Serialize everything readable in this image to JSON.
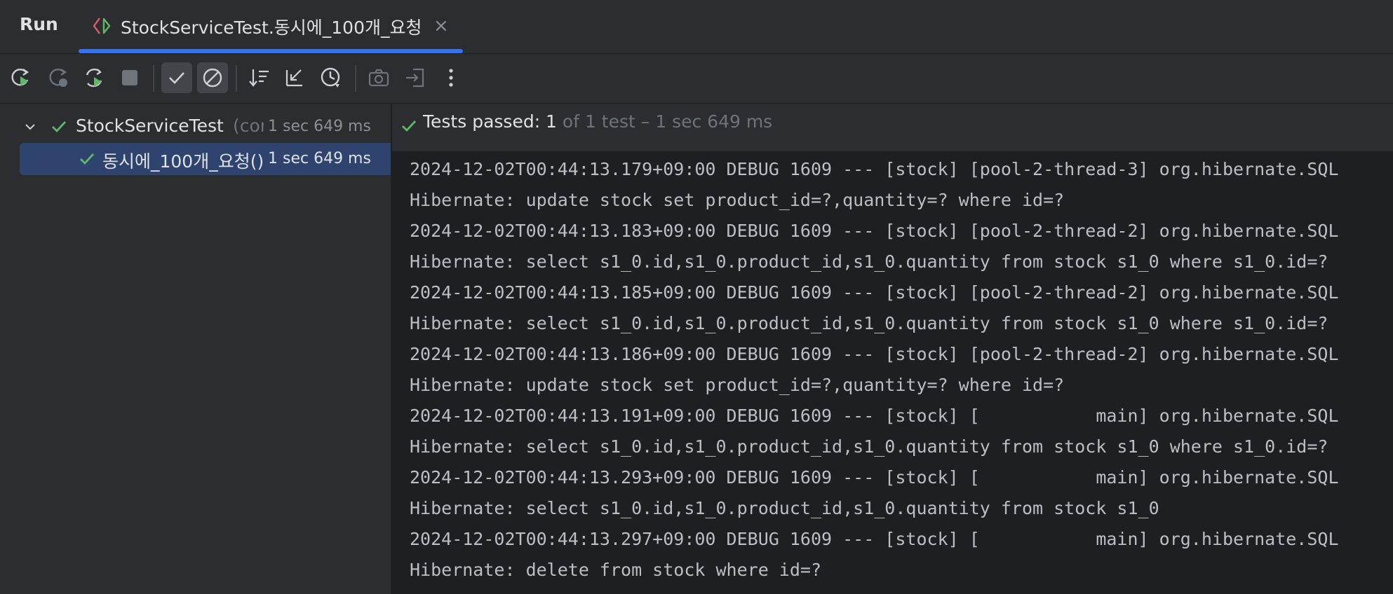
{
  "tabbar": {
    "run_label": "Run",
    "tab_title": "StockServiceTest.동시에_100개_요청",
    "close_glyph": "×"
  },
  "toolbar": {
    "buttons": [
      "rerun-icon",
      "rerun-failed-icon",
      "toggle-auto-test-icon",
      "stop-icon",
      "show-passed-icon",
      "show-ignored-icon",
      "sort-icon",
      "collapse-icon",
      "history-icon",
      "export-icon",
      "import-icon",
      "more-icon"
    ]
  },
  "tree": {
    "root": {
      "name": "StockServiceTest",
      "extra": "(com",
      "time": "1 sec 649 ms"
    },
    "child": {
      "name": "동시에_100개_요청()",
      "time": "1 sec 649 ms"
    }
  },
  "status": {
    "passed_label": "Tests passed: 1",
    "detail": " of 1 test – 1 sec 649 ms"
  },
  "console": {
    "lines": [
      "2024-12-02T00:44:13.179+09:00 DEBUG 1609 --- [stock] [pool-2-thread-3] org.hibernate.SQL",
      "Hibernate: update stock set product_id=?,quantity=? where id=?",
      "2024-12-02T00:44:13.183+09:00 DEBUG 1609 --- [stock] [pool-2-thread-2] org.hibernate.SQL",
      "Hibernate: select s1_0.id,s1_0.product_id,s1_0.quantity from stock s1_0 where s1_0.id=?",
      "2024-12-02T00:44:13.185+09:00 DEBUG 1609 --- [stock] [pool-2-thread-2] org.hibernate.SQL",
      "Hibernate: select s1_0.id,s1_0.product_id,s1_0.quantity from stock s1_0 where s1_0.id=?",
      "2024-12-02T00:44:13.186+09:00 DEBUG 1609 --- [stock] [pool-2-thread-2] org.hibernate.SQL",
      "Hibernate: update stock set product_id=?,quantity=? where id=?",
      "2024-12-02T00:44:13.191+09:00 DEBUG 1609 --- [stock] [           main] org.hibernate.SQL",
      "Hibernate: select s1_0.id,s1_0.product_id,s1_0.quantity from stock s1_0 where s1_0.id=?",
      "2024-12-02T00:44:13.293+09:00 DEBUG 1609 --- [stock] [           main] org.hibernate.SQL",
      "Hibernate: select s1_0.id,s1_0.product_id,s1_0.quantity from stock s1_0",
      "2024-12-02T00:44:13.297+09:00 DEBUG 1609 --- [stock] [           main] org.hibernate.SQL",
      "Hibernate: delete from stock where id=?"
    ]
  },
  "colors": {
    "accent": "#3574f0",
    "success": "#5fb865",
    "selection": "#2e436e"
  }
}
